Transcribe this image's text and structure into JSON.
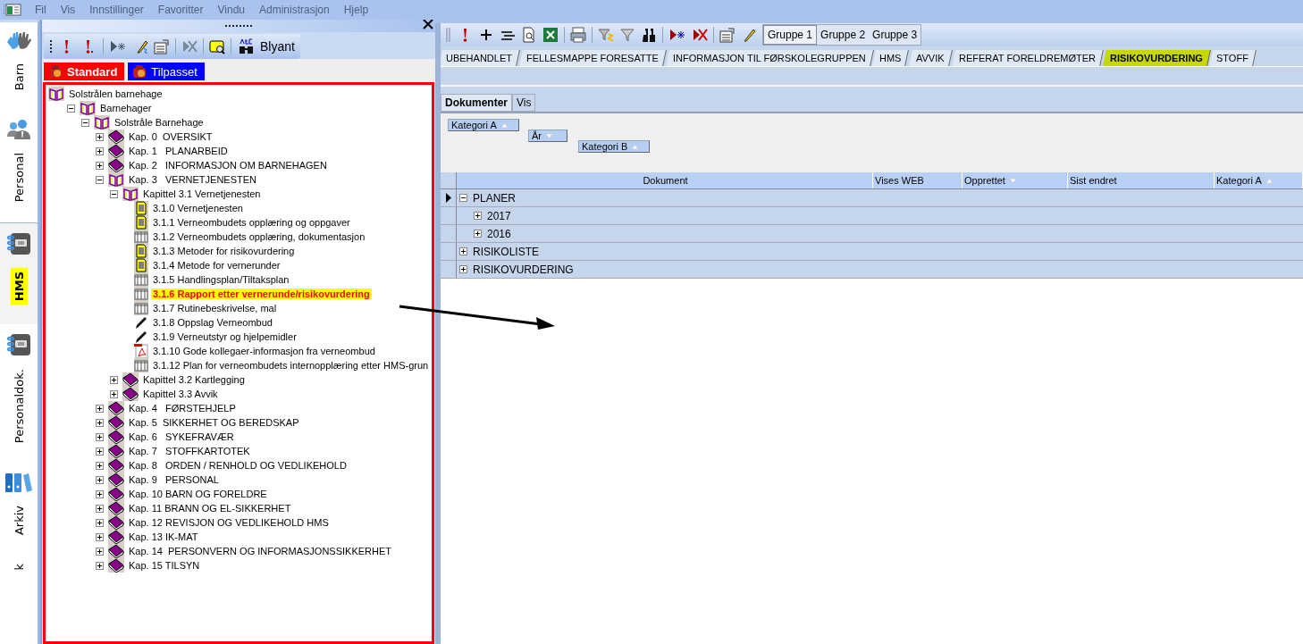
{
  "menu": [
    {
      "label": "Fil",
      "disabled": true
    },
    {
      "label": "Vis",
      "disabled": true
    },
    {
      "label": "Innstillinger",
      "disabled": true
    },
    {
      "label": "Favoritter",
      "disabled": true
    },
    {
      "label": "Vindu",
      "disabled": true
    },
    {
      "label": "Administrasjon",
      "disabled": true
    },
    {
      "label": "Hjelp",
      "disabled": true
    }
  ],
  "sidebar": {
    "items": [
      {
        "label": "Barn",
        "kind": "hands",
        "selected": false
      },
      {
        "label": "Personal",
        "kind": "people",
        "selected": false
      },
      {
        "label": "HMS",
        "kind": "notebook",
        "selected": true
      },
      {
        "label": "Personaldok.",
        "kind": "notebook",
        "selected": false
      },
      {
        "label": "Arkiv",
        "kind": "binders",
        "selected": false
      },
      {
        "label": "k",
        "selected": false
      }
    ]
  },
  "tree_panel": {
    "toolbar_label": "Blyant",
    "tabs": [
      {
        "label": "Standard",
        "color": "#ff0000",
        "selected": true
      },
      {
        "label": "Tilpasset",
        "color": "#0000ff",
        "selected": false
      }
    ],
    "tree": [
      {
        "label": "Solstrålen barnehage",
        "kind": "folder",
        "selected": false,
        "children": [
          {
            "label": "Barnehager",
            "kind": "folder",
            "expanded": true,
            "selected": false,
            "children": [
              {
                "label": "Solstråle Barnehage",
                "kind": "folder",
                "expanded": true,
                "selected": false,
                "children": [
                  {
                    "label": "Kap. 0  OVERSIKT",
                    "kind": "book",
                    "expanded": false,
                    "selected": false
                  },
                  {
                    "label": "Kap. 1   PLANARBEID",
                    "kind": "book",
                    "expanded": false,
                    "selected": false
                  },
                  {
                    "label": "Kap. 2   INFORMASJON OM BARNEHAGEN",
                    "kind": "book",
                    "expanded": false,
                    "selected": false
                  },
                  {
                    "label": "Kap. 3   VERNETJENESTEN",
                    "kind": "folder",
                    "expanded": true,
                    "selected": false,
                    "children": [
                      {
                        "label": "Kapittel 3.1 Vernetjenesten",
                        "kind": "folder",
                        "expanded": true,
                        "selected": false,
                        "children": [
                          {
                            "label": "3.1.0 Vernetjenesten",
                            "kind": "doc",
                            "selected": false
                          },
                          {
                            "label": "3.1.1 Verneombudets opplæring og oppgaver",
                            "kind": "doc",
                            "selected": false
                          },
                          {
                            "label": "3.1.2 Verneombudets opplæring, dokumentasjon",
                            "kind": "table",
                            "selected": false
                          },
                          {
                            "label": "3.1.3 Metoder for risikovurdering",
                            "kind": "doc",
                            "selected": false
                          },
                          {
                            "label": "3.1.4 Metode for vernerunder",
                            "kind": "doc",
                            "selected": false
                          },
                          {
                            "label": "3.1.5 Handlingsplan/Tiltaksplan",
                            "kind": "table",
                            "selected": false
                          },
                          {
                            "label": "3.1.6 Rapport etter vernerunde/risikovurdering",
                            "kind": "table",
                            "selected": true
                          },
                          {
                            "label": "3.1.7 Rutinebeskrivelse, mal",
                            "kind": "table",
                            "selected": false
                          },
                          {
                            "label": "3.1.8 Oppslag Verneombud",
                            "kind": "pen",
                            "selected": false
                          },
                          {
                            "label": "3.1.9 Verneutstyr og hjelpemidler",
                            "kind": "pen",
                            "selected": false
                          },
                          {
                            "label": "3.1.10 Gode kollegaer-informasjon fra verneombud",
                            "kind": "pdf",
                            "selected": false
                          },
                          {
                            "label": "3.1.12 Plan for verneombudets internopplæring etter HMS-grun",
                            "kind": "table",
                            "selected": false
                          }
                        ]
                      },
                      {
                        "label": "Kapittel 3.2 Kartlegging",
                        "kind": "book",
                        "expanded": false,
                        "selected": false
                      },
                      {
                        "label": "Kapittel 3.3 Avvik",
                        "kind": "book",
                        "expanded": false,
                        "selected": false
                      }
                    ]
                  },
                  {
                    "label": "Kap. 4   FØRSTEHJELP",
                    "kind": "book",
                    "expanded": false,
                    "selected": false
                  },
                  {
                    "label": "Kap. 5  SIKKERHET OG BEREDSKAP",
                    "kind": "book",
                    "expanded": false,
                    "selected": false
                  },
                  {
                    "label": "Kap. 6   SYKEFRAVÆR",
                    "kind": "book",
                    "expanded": false,
                    "selected": false
                  },
                  {
                    "label": "Kap. 7   STOFFKARTOTEK",
                    "kind": "book",
                    "expanded": false,
                    "selected": false
                  },
                  {
                    "label": "Kap. 8   ORDEN / RENHOLD OG VEDLIKEHOLD",
                    "kind": "book",
                    "expanded": false,
                    "selected": false
                  },
                  {
                    "label": "Kap. 9   PERSONAL",
                    "kind": "book",
                    "expanded": false,
                    "selected": false
                  },
                  {
                    "label": "Kap. 10 BARN OG FORELDRE",
                    "kind": "book",
                    "expanded": false,
                    "selected": false
                  },
                  {
                    "label": "Kap. 11 BRANN OG EL-SIKKERHET",
                    "kind": "book",
                    "expanded": false,
                    "selected": false
                  },
                  {
                    "label": "Kap. 12 REVISJON OG VEDLIKEHOLD HMS",
                    "kind": "book",
                    "expanded": false,
                    "selected": false
                  },
                  {
                    "label": "Kap. 13 IK-MAT",
                    "kind": "book",
                    "expanded": false,
                    "selected": false
                  },
                  {
                    "label": "Kap. 14  PERSONVERN OG INFORMASJONSSIKKERHET",
                    "kind": "book",
                    "expanded": false,
                    "selected": false
                  },
                  {
                    "label": "Kap. 15 TILSYN",
                    "kind": "book",
                    "expanded": false,
                    "selected": false
                  }
                ]
              }
            ]
          }
        ]
      }
    ]
  },
  "doc_panel": {
    "group_buttons": [
      {
        "label": "Gruppe 1",
        "selected": true
      },
      {
        "label": "Gruppe 2",
        "selected": false
      },
      {
        "label": "Gruppe 3",
        "selected": false
      }
    ],
    "folder_tabs": [
      {
        "label": "UBEHANDLET",
        "selected": false
      },
      {
        "label": "FELLESMAPPE FORESATTE",
        "selected": false
      },
      {
        "label": "INFORMASJON TIL FØRSKOLEGRUPPEN",
        "selected": false
      },
      {
        "label": "HMS",
        "selected": false
      },
      {
        "label": "AVVIK",
        "selected": false
      },
      {
        "label": "REFERAT FORELDREMØTER",
        "selected": false
      },
      {
        "label": "RISIKOVURDERING",
        "selected": true
      },
      {
        "label": "STOFF",
        "selected": false
      }
    ],
    "view_tabs": [
      {
        "label": "Dokumenter",
        "selected": true
      },
      {
        "label": "Vis",
        "selected": false
      }
    ],
    "group_by": [
      {
        "label": "Kategori A",
        "sorted": true,
        "descending": false
      },
      {
        "label": "År",
        "sorted": true,
        "descending": true
      },
      {
        "label": "Kategori B",
        "sorted": true,
        "descending": false
      }
    ],
    "grid": {
      "columns": [
        {
          "label": "Dokument",
          "sorted": false
        },
        {
          "label": "Vises WEB",
          "sorted": false
        },
        {
          "label": "Opprettet",
          "sorted": true,
          "descending": true
        },
        {
          "label": "Sist endret",
          "sorted": false
        },
        {
          "label": "Kategori A",
          "sorted": true,
          "descending": false
        }
      ],
      "rows": [
        {
          "label": "PLANER",
          "expanded": true,
          "current": true,
          "children": [
            {
              "label": "2017",
              "expanded": false,
              "current": false
            },
            {
              "label": "2016",
              "expanded": false,
              "current": false
            }
          ]
        },
        {
          "label": "RISIKOLISTE",
          "expanded": false,
          "current": false
        },
        {
          "label": "RISIKOVURDERING",
          "expanded": false,
          "current": false
        }
      ]
    }
  }
}
